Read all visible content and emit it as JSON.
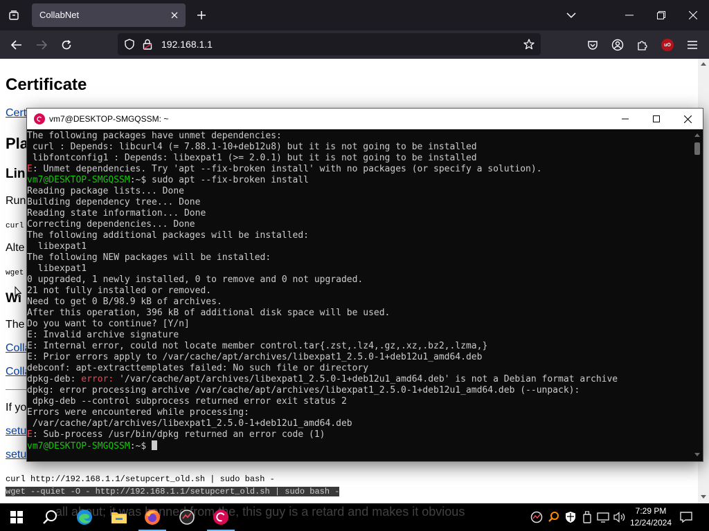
{
  "browser": {
    "tab_title": "CollabNet",
    "url": "192.168.1.1"
  },
  "page": {
    "heading": "Certificate",
    "link_certificate": "Cert",
    "h2_platform": "Pla",
    "h3_linux": "Lin",
    "run_text": "Run",
    "code_curl": "curl",
    "alt_text": "Alte",
    "code_wget": "wget",
    "h3_windows": "Wi",
    "the_text": "The",
    "link_collab_1": "Colla",
    "link_collab_2": "Colla",
    "if_text": "If yo",
    "link_setup_1": "setu",
    "link_setup_2": "setu",
    "cmd_curl": "curl http://192.168.1.1/setupcert_old.sh | sudo bash -",
    "cmd_wget": "wget --quiet -O - http://192.168.1.1/setupcert_old.sh | sudo bash -"
  },
  "terminal": {
    "title": "vm7@DESKTOP-SMGQSSM: ~",
    "lines": [
      {
        "parts": [
          {
            "t": "The following packages have unmet dependencies:",
            "c": ""
          }
        ]
      },
      {
        "parts": [
          {
            "t": " curl : Depends: libcurl4 (= 7.88.1-10+deb12u8) but it is not going to be installed",
            "c": ""
          }
        ]
      },
      {
        "parts": [
          {
            "t": " libfontconfig1 : Depends: libexpat1 (>= 2.0.1) but it is not going to be installed",
            "c": ""
          }
        ]
      },
      {
        "parts": [
          {
            "t": "E",
            "c": "terr"
          },
          {
            "t": ": Unmet dependencies. Try 'apt --fix-broken install' with no packages (or specify a solution).",
            "c": ""
          }
        ]
      },
      {
        "parts": [
          {
            "t": "vm7@DESKTOP-SMGQSSM",
            "c": "tprompt"
          },
          {
            "t": ":~$ sudo apt --fix-broken install",
            "c": ""
          }
        ]
      },
      {
        "parts": [
          {
            "t": "Reading package lists... Done",
            "c": ""
          }
        ]
      },
      {
        "parts": [
          {
            "t": "Building dependency tree... Done",
            "c": ""
          }
        ]
      },
      {
        "parts": [
          {
            "t": "Reading state information... Done",
            "c": ""
          }
        ]
      },
      {
        "parts": [
          {
            "t": "Correcting dependencies... Done",
            "c": ""
          }
        ]
      },
      {
        "parts": [
          {
            "t": "The following additional packages will be installed:",
            "c": ""
          }
        ]
      },
      {
        "parts": [
          {
            "t": "  libexpat1",
            "c": ""
          }
        ]
      },
      {
        "parts": [
          {
            "t": "The following NEW packages will be installed:",
            "c": ""
          }
        ]
      },
      {
        "parts": [
          {
            "t": "  libexpat1",
            "c": ""
          }
        ]
      },
      {
        "parts": [
          {
            "t": "0 upgraded, 1 newly installed, 0 to remove and 0 not upgraded.",
            "c": ""
          }
        ]
      },
      {
        "parts": [
          {
            "t": "21 not fully installed or removed.",
            "c": ""
          }
        ]
      },
      {
        "parts": [
          {
            "t": "Need to get 0 B/98.9 kB of archives.",
            "c": ""
          }
        ]
      },
      {
        "parts": [
          {
            "t": "After this operation, 396 kB of additional disk space will be used.",
            "c": ""
          }
        ]
      },
      {
        "parts": [
          {
            "t": "Do you want to continue? [Y/n]",
            "c": ""
          }
        ]
      },
      {
        "parts": [
          {
            "t": "E: Invalid archive signature",
            "c": ""
          }
        ]
      },
      {
        "parts": [
          {
            "t": "E: Internal error, could not locate member control.tar{.zst,.lz4,.gz,.xz,.bz2,.lzma,}",
            "c": ""
          }
        ]
      },
      {
        "parts": [
          {
            "t": "E: Prior errors apply to /var/cache/apt/archives/libexpat1_2.5.0-1+deb12u1_amd64.deb",
            "c": ""
          }
        ]
      },
      {
        "parts": [
          {
            "t": "debconf: apt-extracttemplates failed: No such file or directory",
            "c": ""
          }
        ]
      },
      {
        "parts": [
          {
            "t": "dpkg-deb: ",
            "c": ""
          },
          {
            "t": "error:",
            "c": "terr"
          },
          {
            "t": " '/var/cache/apt/archives/libexpat1_2.5.0-1+deb12u1_amd64.deb' is not a Debian format archive",
            "c": ""
          }
        ]
      },
      {
        "parts": [
          {
            "t": "dpkg: error processing archive /var/cache/apt/archives/libexpat1_2.5.0-1+deb12u1_amd64.deb (--unpack):",
            "c": ""
          }
        ]
      },
      {
        "parts": [
          {
            "t": " dpkg-deb --control subprocess returned error exit status 2",
            "c": ""
          }
        ]
      },
      {
        "parts": [
          {
            "t": "Errors were encountered while processing:",
            "c": ""
          }
        ]
      },
      {
        "parts": [
          {
            "t": " /var/cache/apt/archives/libexpat1_2.5.0-1+deb12u1_amd64.deb",
            "c": ""
          }
        ]
      },
      {
        "parts": [
          {
            "t": "E",
            "c": "terr"
          },
          {
            "t": ": Sub-process /usr/bin/dpkg returned an error code (1)",
            "c": ""
          }
        ]
      },
      {
        "parts": [
          {
            "t": "vm7@DESKTOP-SMGQSSM",
            "c": "tprompt"
          },
          {
            "t": ":~$ ",
            "c": ""
          }
        ],
        "cursor": true
      }
    ]
  },
  "taskbar": {
    "overlay_text": "all about; it was banned from the, this guy is a retard and makes it obvious",
    "time": "7:29 PM",
    "date": "12/24/2024"
  },
  "colors": {
    "prompt_green": "#16c60c",
    "error_red": "#e74856",
    "terminal_bg": "#0c0c0c",
    "link_blue": "#0645ad"
  }
}
